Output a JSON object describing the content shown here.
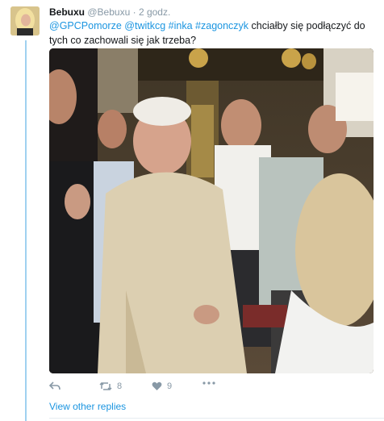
{
  "tweet": {
    "author_name": "Bebuxu",
    "author_handle": "@Bebuxu",
    "separator": "·",
    "time": "2 godz.",
    "mentions": [
      "@GPCPomorze",
      "@twitkcg",
      "#inka",
      "#zagonczyk"
    ],
    "text": "chciałby się podłączyć do tych co zachowali się jak trzeba?",
    "reply_count": "",
    "retweet_count": "8",
    "like_count": "9"
  },
  "thread": {
    "other_replies_label": "View other replies"
  },
  "icons": {
    "reply": "reply-icon",
    "retweet": "retweet-icon",
    "like": "heart-icon",
    "more": "more-icon"
  },
  "colors": {
    "link": "#1b95e0",
    "muted": "#8899a6",
    "thread_line": "#9fd1f0"
  }
}
